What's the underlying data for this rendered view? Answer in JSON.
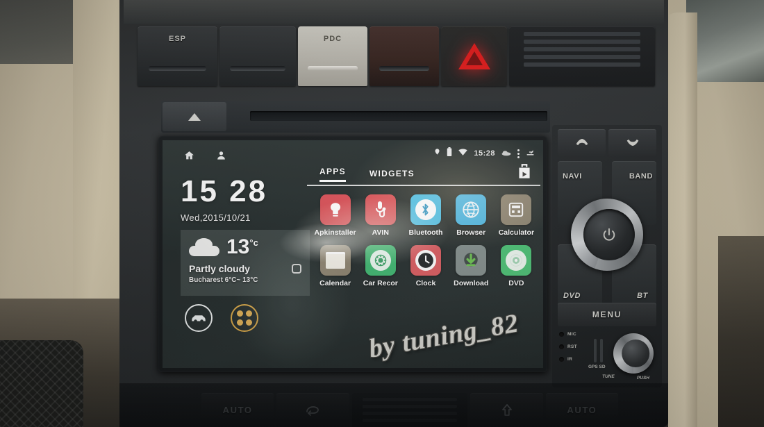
{
  "device": {
    "type": "car-android-head-unit",
    "watermark": "by tuning_82"
  },
  "dashboard": {
    "top_switches": [
      {
        "label": "ESP",
        "name": "esp-button",
        "style": "dark"
      },
      {
        "label": "",
        "name": "blank-switch-1",
        "style": "dark"
      },
      {
        "label": "PDC",
        "name": "pdc-button",
        "style": "white"
      },
      {
        "label": "",
        "name": "amber-switch",
        "style": "amber"
      },
      {
        "label": "",
        "name": "hazard-button",
        "style": "hazard"
      },
      {
        "label": "",
        "name": "dash-vent-top",
        "style": "vent"
      }
    ],
    "eject_icon": "eject-icon",
    "cd_slot_name": "cd-slot"
  },
  "controls": {
    "phone_answer_icon": "phone-answer-icon",
    "phone_hangup_icon": "phone-hangup-icon",
    "navi_label": "NAVI",
    "band_label": "BAND",
    "dvd_label": "DVD",
    "bt_label": "BT",
    "menu_label": "MENU",
    "power_icon": "power-icon",
    "mic_label": "MIC",
    "rst_label": "RST",
    "ir_label": "IR",
    "gps_label": "GPS SD",
    "tune_label": "TUNE",
    "push_label": "PUSH"
  },
  "climate": {
    "buttons": [
      {
        "label": "AUTO",
        "name": "climate-auto-left",
        "kind": "text"
      },
      {
        "label": "",
        "name": "climate-recirculate",
        "kind": "recirc-icon"
      },
      {
        "label": "",
        "name": "climate-center-vent",
        "kind": "vent"
      },
      {
        "label": "",
        "name": "climate-defrost",
        "kind": "arrow-icon"
      },
      {
        "label": "AUTO",
        "name": "climate-auto-right",
        "kind": "text"
      }
    ]
  },
  "screen": {
    "nav": {
      "home_icon": "home-icon",
      "recents_icon": "recents-icon"
    },
    "statusbar": {
      "gps_icon": "gps-pin-icon",
      "battery_icon": "battery-icon",
      "wifi_icon": "wifi-icon",
      "time": "15:28",
      "cloud_icon": "cloud-icon",
      "overflow_icon": "overflow-menu-icon",
      "eject_icon": "sd-eject-icon"
    },
    "clock_widget": {
      "time": "15 28",
      "date": "Wed,2015/10/21"
    },
    "weather_widget": {
      "condition_icon": "cloud-icon",
      "temperature": "13",
      "temp_unit": "°c",
      "condition": "Partly cloudy",
      "range": "Bucharest 6°C~ 13°C",
      "refresh_icon": "refresh-icon"
    },
    "dock": [
      {
        "name": "dock-car-mode",
        "icon": "car-icon",
        "color": "#eef2f2"
      },
      {
        "name": "dock-app-drawer",
        "icon": "apps-grid-icon",
        "color": "#e0a83c"
      }
    ],
    "drawer": {
      "tabs": [
        {
          "label": "APPS",
          "active": true,
          "name": "tab-apps"
        },
        {
          "label": "WIDGETS",
          "active": false,
          "name": "tab-widgets"
        }
      ],
      "playstore_icon": "play-store-icon",
      "apps": [
        {
          "label": "Apkinstaller",
          "display": "Apkinstaller",
          "icon": "apk-installer-icon",
          "color": "#e2484f"
        },
        {
          "label": "AVIN",
          "display": "AVIN",
          "icon": "avin-icon",
          "color": "#e2484f"
        },
        {
          "label": "Bluetooth",
          "display": "Bluetooth",
          "icon": "bluetooth-icon",
          "color": "#3cc0e8"
        },
        {
          "label": "Browser",
          "display": "Browser",
          "icon": "browser-globe-icon",
          "color": "#3cb8e8"
        },
        {
          "label": "Calculator",
          "display": "Calculator",
          "icon": "calculator-icon",
          "color": "#8a7f6a"
        },
        {
          "label": "Calendar",
          "display": "Calendar",
          "icon": "calendar-icon",
          "color": "#8a7f6a"
        },
        {
          "label": "Car Recorder",
          "display": "Car Recor",
          "icon": "car-recorder-icon",
          "color": "#32b869"
        },
        {
          "label": "Clock",
          "display": "Clock",
          "icon": "clock-icon",
          "color": "#e2555a"
        },
        {
          "label": "Download",
          "display": "Download",
          "icon": "download-icon",
          "color": "#7f8c8a"
        },
        {
          "label": "DVD",
          "display": "DVD",
          "icon": "dvd-disc-icon",
          "color": "#3fc46e"
        }
      ]
    }
  }
}
